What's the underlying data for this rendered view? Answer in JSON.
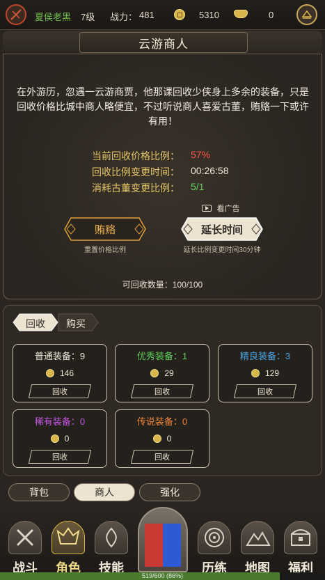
{
  "topbar": {
    "player_name": "夏侯老黑",
    "level": "7级",
    "power_label": "战力：",
    "power_value": "481",
    "gold": "5310",
    "ingot": "0"
  },
  "merchant": {
    "title": "云游商人",
    "description": "在外游历，忽遇一云游商贾，他那课回收少侠身上多余的装备，只是回收价格比城中商人略便宜，不过听说商人喜爱古董，贿赂一下或许有用！",
    "rows": [
      {
        "label": "当前回收价格比例：",
        "value": "57%"
      },
      {
        "label": "回收比例变更时间：",
        "value": "00:26:58"
      },
      {
        "label": "消耗古董变更比例：",
        "value": "5/1"
      }
    ],
    "watch_ad_label": "看广告",
    "bribe_button": "贿赂",
    "bribe_caption": "重置价格比例",
    "extend_button": "延长时间",
    "extend_caption": "延长比例变更时间30分钟",
    "recycle_count": "可回收数量：100/100"
  },
  "tabs": {
    "recycle": "回收",
    "buy": "购买"
  },
  "equipment": [
    {
      "title": "普通装备：9",
      "price": "146",
      "button": "回收",
      "color": "#f1ead8"
    },
    {
      "title": "优秀装备：1",
      "price": "29",
      "button": "回收",
      "color": "#5fd35a"
    },
    {
      "title": "精良装备：3",
      "price": "129",
      "button": "回收",
      "color": "#4aa8e8"
    },
    {
      "title": "稀有装备：0",
      "price": "0",
      "button": "回收",
      "color": "#c857e6"
    },
    {
      "title": "传说装备：0",
      "price": "0",
      "button": "回收",
      "color": "#f0883a"
    }
  ],
  "subtabs": [
    "背包",
    "商人",
    "强化"
  ],
  "nav": [
    "战斗",
    "角色",
    "技能",
    "历练",
    "地图",
    "福利"
  ],
  "xp": {
    "text": "519/600 (86%)",
    "progress": 0.86
  },
  "colors": {
    "accent_gold": "#e6c766",
    "price_red": "#ff5a4e",
    "green": "#5fd35a"
  }
}
